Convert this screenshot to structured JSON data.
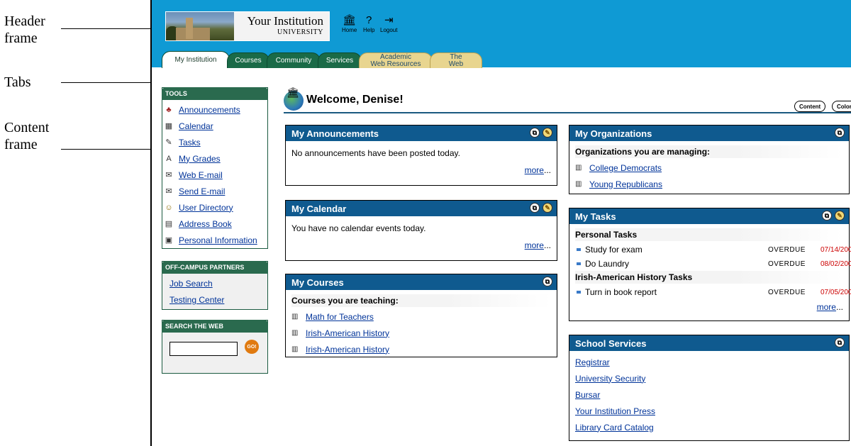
{
  "annotations": {
    "header_frame": [
      "Header",
      "frame"
    ],
    "tabs": "Tabs",
    "content_frame": [
      "Content",
      "frame"
    ]
  },
  "header": {
    "logo_line1": "Your Institution",
    "logo_line2": "UNIVERSITY",
    "icons": [
      {
        "label": "Home",
        "icon": "home-icon"
      },
      {
        "label": "Help",
        "icon": "help-icon"
      },
      {
        "label": "Logout",
        "icon": "logout-icon"
      }
    ]
  },
  "tabs": [
    {
      "label": "My Institution",
      "active": true
    },
    {
      "label": "Courses"
    },
    {
      "label": "Community"
    },
    {
      "label": "Services"
    },
    {
      "label": "Academic Web Resources",
      "line1": "Academic",
      "line2": "Web Resources"
    },
    {
      "label": "The Web",
      "line1": "The",
      "line2": "Web"
    }
  ],
  "tools": {
    "title": "TOOLS",
    "items": [
      {
        "label": "Announcements",
        "icon": "announcements-icon"
      },
      {
        "label": "Calendar",
        "icon": "calendar-icon"
      },
      {
        "label": "Tasks",
        "icon": "tasks-icon"
      },
      {
        "label": "My Grades",
        "icon": "grades-icon"
      },
      {
        "label": "Web E-mail",
        "icon": "email-icon"
      },
      {
        "label": "Send E-mail",
        "icon": "send-email-icon"
      },
      {
        "label": "User Directory",
        "icon": "user-directory-icon"
      },
      {
        "label": "Address Book",
        "icon": "address-book-icon"
      },
      {
        "label": "Personal Information",
        "icon": "personal-info-icon"
      }
    ]
  },
  "partners": {
    "title": "OFF-CAMPUS PARTNERS",
    "items": [
      "Job Search",
      "Testing Center"
    ]
  },
  "search": {
    "title": "SEARCH THE WEB",
    "go": "GO!"
  },
  "welcome": {
    "text": "Welcome, Denise!",
    "content_btn": "Content",
    "colors_btn": "Colors"
  },
  "announcements": {
    "title": "My Announcements",
    "text": "No announcements have been posted today.",
    "more": "more"
  },
  "calendar": {
    "title": "My Calendar",
    "text": "You have no calendar events today.",
    "more": "more"
  },
  "courses": {
    "title": "My Courses",
    "subhead": "Courses you are teaching:",
    "items": [
      "Math for Teachers",
      "Irish-American History",
      "Irish-American History"
    ]
  },
  "organizations": {
    "title": "My Organizations",
    "subhead": "Organizations you are managing:",
    "items": [
      "College Democrats",
      "Young Republicans"
    ]
  },
  "tasks": {
    "title": "My Tasks",
    "groups": [
      {
        "name": "Personal Tasks",
        "items": [
          {
            "label": "Study for exam",
            "status": "OVERDUE",
            "date": "07/14/200"
          },
          {
            "label": "Do Laundry",
            "status": "OVERDUE",
            "date": "08/02/200"
          }
        ]
      },
      {
        "name": "Irish-American History Tasks",
        "items": [
          {
            "label": "Turn in book report",
            "status": "OVERDUE",
            "date": "07/05/200"
          }
        ]
      }
    ],
    "more": "more"
  },
  "services": {
    "title": "School Services",
    "items": [
      "Registrar",
      "University Security",
      "Bursar",
      "Your Institution Press",
      "Library Card Catalog"
    ]
  },
  "colors": {
    "header_blue": "#0f9ad4",
    "tab_green": "#1a6a47",
    "tab_tan": "#e8d58f",
    "module_header": "#0f5a8f",
    "overdue_date": "#cc0000"
  }
}
